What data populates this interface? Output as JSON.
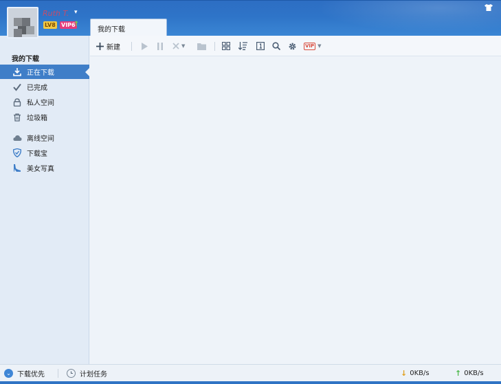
{
  "user": {
    "name": "Ruth T.",
    "level_badge": "LV8",
    "vip_badge": "VIP6"
  },
  "tab": {
    "label": "我的下载"
  },
  "sidebar": {
    "title": "我的下载",
    "items": [
      {
        "label": "正在下载",
        "icon": "download-icon",
        "active": true
      },
      {
        "label": "已完成",
        "icon": "checkmark-icon",
        "active": false
      },
      {
        "label": "私人空间",
        "icon": "lock-icon",
        "active": false
      },
      {
        "label": "垃圾箱",
        "icon": "trash-icon",
        "active": false
      },
      {
        "label": "离线空间",
        "icon": "cloud-icon",
        "active": false
      },
      {
        "label": "下载宝",
        "icon": "shield-icon",
        "active": false
      },
      {
        "label": "美女写真",
        "icon": "high-heel-icon",
        "active": false
      }
    ]
  },
  "toolbar": {
    "new_label": "新建",
    "vip_label": "VIP"
  },
  "statusbar": {
    "priority_label": "下载优先",
    "schedule_label": "计划任务",
    "down_speed": "0KB/s",
    "up_speed": "0KB/s"
  },
  "colors": {
    "header_blue": "#2e74c8",
    "active_item": "#3f7ec8",
    "down_arrow": "#e0a020",
    "up_arrow": "#4cb84a"
  }
}
